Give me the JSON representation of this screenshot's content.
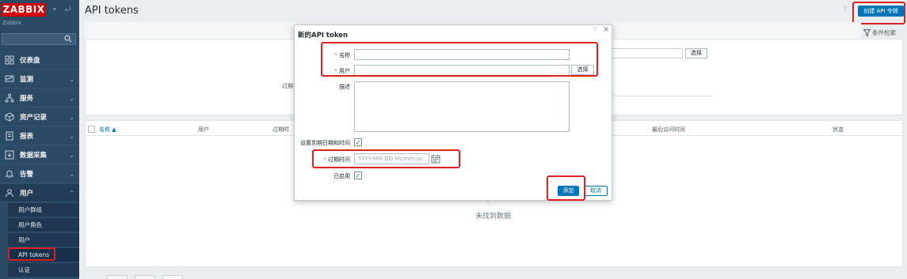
{
  "app": {
    "logo": "ZABBIX",
    "sublogo": "Zabbix",
    "collapse_icon": "«",
    "expand_icon": "⤾"
  },
  "sidebar": {
    "items": [
      {
        "label": "仪表盘",
        "icon": "dashboard-icon"
      },
      {
        "label": "监测",
        "icon": "monitoring-icon"
      },
      {
        "label": "服务",
        "icon": "services-icon"
      },
      {
        "label": "资产记录",
        "icon": "inventory-icon"
      },
      {
        "label": "报表",
        "icon": "reports-icon"
      },
      {
        "label": "数据采集",
        "icon": "data-collection-icon"
      },
      {
        "label": "告警",
        "icon": "alerts-icon"
      },
      {
        "label": "用户",
        "icon": "users-icon"
      }
    ],
    "users_subitems": [
      "用户群组",
      "用户角色",
      "用户",
      "API tokens",
      "认证"
    ],
    "chevron_down": "⌄",
    "chevron_up": "⌃"
  },
  "header": {
    "title": "API tokens",
    "help": "?",
    "create_button": "创建 API 令牌",
    "filter_tab": "条件检索"
  },
  "filter": {
    "select_label": "选择",
    "expires_label": "过期"
  },
  "table": {
    "columns": [
      "名称 ▲",
      "用户",
      "过期时",
      "最后访问时间",
      "状态"
    ],
    "empty_text": "未找到数据"
  },
  "modal": {
    "title": "新的API token",
    "help": "?",
    "close": "×",
    "name_label": "名称",
    "user_label": "用户",
    "user_select": "选择",
    "description_label": "描述",
    "set_expiry_label": "设置到期日期和时间",
    "expires_label": "过期时间",
    "expires_placeholder": "YYYY-MM-DD hh:mm:ss",
    "enabled_label": "已启用",
    "required_mark": "*",
    "check_mark": "✓",
    "add_button": "添加",
    "cancel_button": "取消"
  },
  "colors": {
    "sidebar": "#2b4a66",
    "accent": "#0275b8",
    "logo": "#d40000",
    "annotation": "#e02020"
  }
}
